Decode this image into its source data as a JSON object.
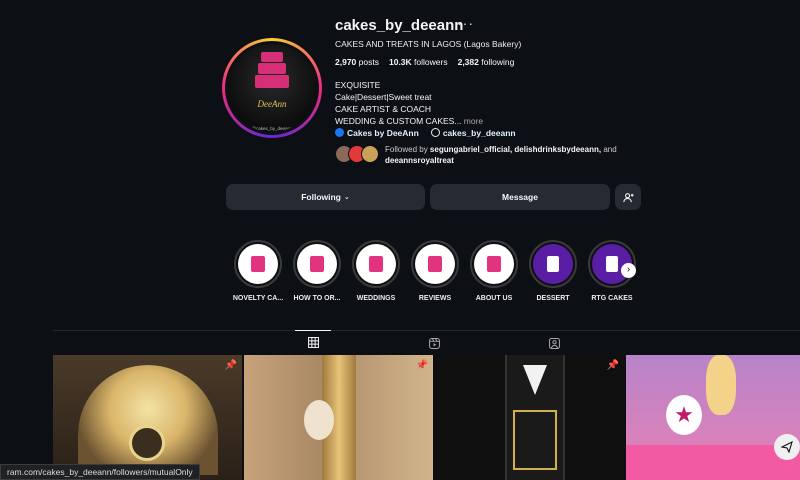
{
  "profile": {
    "username": "cakes_by_deeann",
    "menu_glyph": "···",
    "category": "CAKES AND TREATS IN LAGOS (Lagos Bakery)",
    "stats": {
      "posts_value": "2,970",
      "posts_label": "posts",
      "followers_value": "10.3K",
      "followers_label": "followers",
      "following_value": "2,382",
      "following_label": "following"
    },
    "bio_lines": [
      "EXQUISITE",
      "Cake|Dessert|Sweet treat",
      "CAKE ARTIST & COACH",
      "WEDDING & CUSTOM CAKES..."
    ],
    "bio_more": "more",
    "links": {
      "facebook": "Cakes by DeeAnn",
      "threads": "cakes_by_deeann"
    },
    "followed_by_prefix": "Followed by",
    "followed_by_names": "segungabriel_official, delishdrinksbydeeann,",
    "followed_by_and": "and",
    "followed_by_last": "deeannsroyaltreat",
    "avatar": {
      "brand": "DeeAnn",
      "top": "CAKES",
      "handle": "@cakes_by_deeann"
    }
  },
  "actions": {
    "following": "Following",
    "message": "Message"
  },
  "highlights": [
    {
      "label": "NOVELTY CA...",
      "style": "white"
    },
    {
      "label": "HOW TO OR...",
      "style": "white"
    },
    {
      "label": "WEDDINGS",
      "style": "white"
    },
    {
      "label": "REVIEWS",
      "style": "white"
    },
    {
      "label": "ABOUT US",
      "style": "white"
    },
    {
      "label": "DESSERT",
      "style": "purple"
    },
    {
      "label": "RTG CAKES",
      "style": "purple"
    }
  ],
  "tabs": [
    "grid-icon",
    "reels-icon",
    "tagged-icon"
  ],
  "status_url": "ram.com/cakes_by_deeann/followers/mutualOnly",
  "colors": {
    "accent_pink": "#d62f7a",
    "background": "#0c0f14",
    "button": "#262a31",
    "link": "#e0f1ff"
  }
}
